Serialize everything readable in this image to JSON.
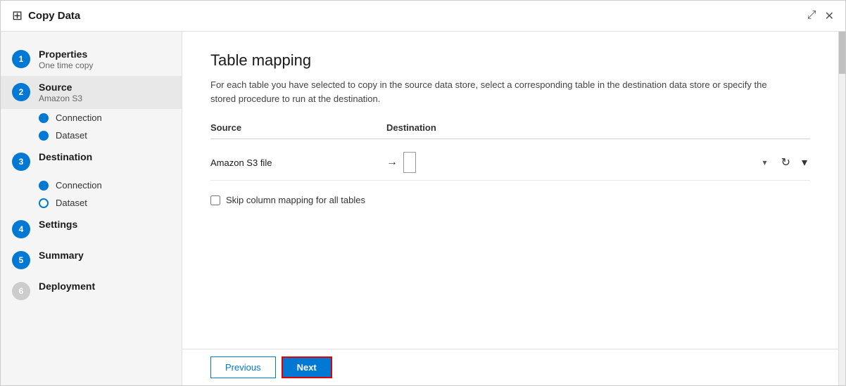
{
  "titleBar": {
    "icon": "⊞",
    "title": "Copy Data",
    "expandLabel": "⤢",
    "closeLabel": "✕"
  },
  "sidebar": {
    "items": [
      {
        "id": "properties",
        "number": "1",
        "label": "Properties",
        "sub": "One time copy",
        "active": false,
        "inactive": false
      },
      {
        "id": "source",
        "number": "2",
        "label": "Source",
        "sub": "Amazon S3",
        "active": true,
        "inactive": false,
        "subItems": [
          {
            "label": "Connection",
            "type": "filled"
          },
          {
            "label": "Dataset",
            "type": "filled"
          }
        ]
      },
      {
        "id": "destination",
        "number": "3",
        "label": "Destination",
        "sub": "",
        "active": false,
        "inactive": false,
        "subItems": [
          {
            "label": "Connection",
            "type": "filled"
          },
          {
            "label": "Dataset",
            "type": "outline"
          }
        ]
      },
      {
        "id": "settings",
        "number": "4",
        "label": "Settings",
        "sub": "",
        "active": false,
        "inactive": false
      },
      {
        "id": "summary",
        "number": "5",
        "label": "Summary",
        "sub": "",
        "active": false,
        "inactive": false
      },
      {
        "id": "deployment",
        "number": "6",
        "label": "Deployment",
        "sub": "",
        "active": false,
        "inactive": true
      }
    ]
  },
  "main": {
    "title": "Table mapping",
    "description": "For each table you have selected to copy in the source data store, select a corresponding table in the destination data store or specify the stored procedure to run at the destination.",
    "tableHeader": {
      "sourceCol": "Source",
      "destCol": "Destination"
    },
    "tableRow": {
      "sourceLabel": "Amazon S3 file",
      "destinationPlaceholder": "",
      "arrowSymbol": "→"
    },
    "checkbox": {
      "label": "Skip column mapping for all tables"
    },
    "footer": {
      "previousLabel": "Previous",
      "nextLabel": "Next"
    }
  }
}
